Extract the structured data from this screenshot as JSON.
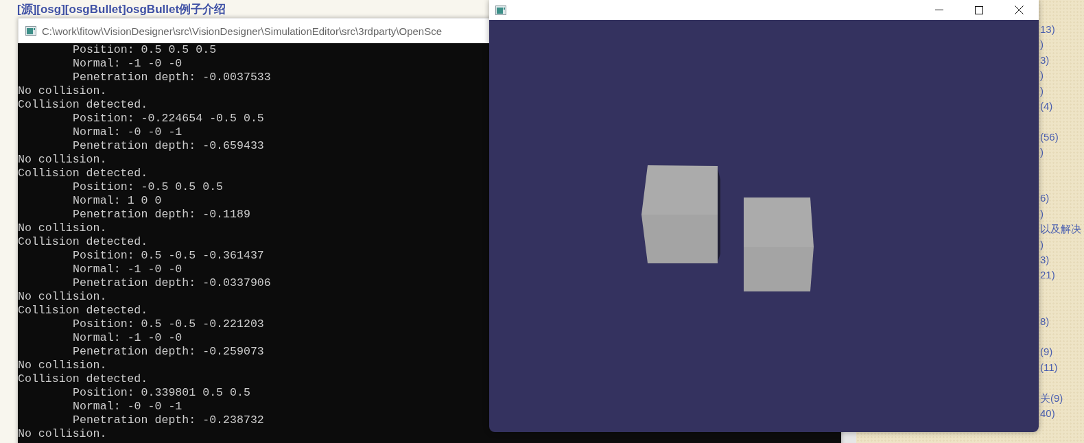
{
  "page": {
    "title": "[源][osg][osgBullet]osgBullet例子介绍",
    "sidebar_items": [
      "13)",
      ")",
      "3)",
      ")",
      ")",
      "(4)",
      "(56)",
      ")",
      "6)",
      ")",
      "以及解决",
      ")",
      "3)",
      "21)",
      "8)",
      "(9)",
      "(11)",
      "关(9)",
      "40)"
    ]
  },
  "console": {
    "title": "C:\\work\\fitow\\VisionDesigner\\src\\VisionDesigner\\SimulationEditor\\src\\3rdparty\\OpenSce",
    "lines": [
      {
        "kind": "detail",
        "text": "Position: 0.5 0.5 0.5"
      },
      {
        "kind": "detail",
        "text": "Normal: -1 -0 -0"
      },
      {
        "kind": "detail",
        "text": "Penetration depth: -0.0037533"
      },
      {
        "kind": "status",
        "text": "No collision."
      },
      {
        "kind": "status",
        "text": "Collision detected."
      },
      {
        "kind": "detail",
        "text": "Position: -0.224654 -0.5 0.5"
      },
      {
        "kind": "detail",
        "text": "Normal: -0 -0 -1"
      },
      {
        "kind": "detail",
        "text": "Penetration depth: -0.659433"
      },
      {
        "kind": "status",
        "text": "No collision."
      },
      {
        "kind": "status",
        "text": "Collision detected."
      },
      {
        "kind": "detail",
        "text": "Position: -0.5 0.5 0.5"
      },
      {
        "kind": "detail",
        "text": "Normal: 1 0 0"
      },
      {
        "kind": "detail",
        "text": "Penetration depth: -0.1189"
      },
      {
        "kind": "status",
        "text": "No collision."
      },
      {
        "kind": "status",
        "text": "Collision detected."
      },
      {
        "kind": "detail",
        "text": "Position: 0.5 -0.5 -0.361437"
      },
      {
        "kind": "detail",
        "text": "Normal: -1 -0 -0"
      },
      {
        "kind": "detail",
        "text": "Penetration depth: -0.0337906"
      },
      {
        "kind": "status",
        "text": "No collision."
      },
      {
        "kind": "status",
        "text": "Collision detected."
      },
      {
        "kind": "detail",
        "text": "Position: 0.5 -0.5 -0.221203"
      },
      {
        "kind": "detail",
        "text": "Normal: -1 -0 -0"
      },
      {
        "kind": "detail",
        "text": "Penetration depth: -0.259073"
      },
      {
        "kind": "status",
        "text": "No collision."
      },
      {
        "kind": "status",
        "text": "Collision detected."
      },
      {
        "kind": "detail",
        "text": "Position: 0.339801 0.5 0.5"
      },
      {
        "kind": "detail",
        "text": "Normal: -0 -0 -1"
      },
      {
        "kind": "detail",
        "text": "Penetration depth: -0.238732"
      },
      {
        "kind": "status",
        "text": "No collision."
      }
    ]
  }
}
